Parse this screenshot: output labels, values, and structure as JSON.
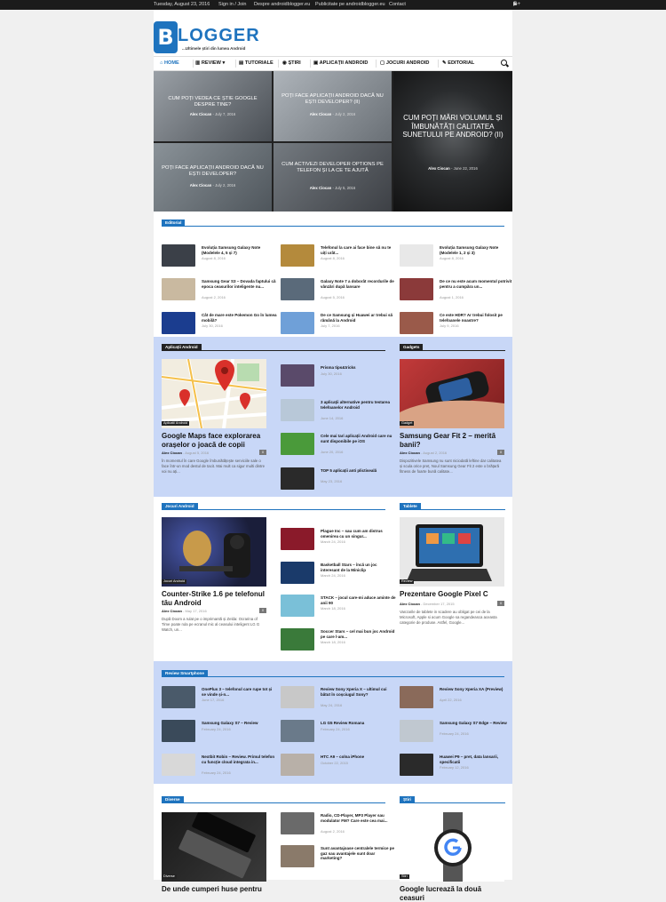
{
  "topbar": {
    "date": "Tuesday, August 23, 2016",
    "signin": "Sign in / Join",
    "about": "Despre androidblogger.eu",
    "ads": "Publicitate pe androidblogger.eu",
    "contact": "Contact",
    "icons": [
      "facebook-icon",
      "google-plus-icon",
      "instagram-icon",
      "youtube-icon"
    ]
  },
  "logo": {
    "letter": "B",
    "text": "LOGGER",
    "tagline": "...Ultimele știri din lumea Android"
  },
  "nav": {
    "items": [
      "HOME",
      "REVIEW",
      "TUTORIALE",
      "ȘTIRI",
      "APLICAȚII ANDROID",
      "JOCURI ANDROID",
      "EDITORIAL"
    ]
  },
  "hero": [
    {
      "title": "CUM POȚI VEDEA CE ȘTIE GOOGLE DESPRE TINE?",
      "author": "Alex Ciocan",
      "date": "July 7, 2016",
      "bg": "#6b7178"
    },
    {
      "title": "POȚI FACE APLICAȚII ANDROID DACĂ NU EȘTI DEVELOPER? (II)",
      "author": "Alex Ciocan",
      "date": "July 2, 2016",
      "bg": "#8a9096"
    },
    {
      "title": "CUM POȚI MĂRI VOLUMUL ȘI ÎMBUNĂTĂȚI CALITATEA SUNETULUI PE ANDROID? (II)",
      "author": "Alex Ciocan",
      "date": "June 22, 2016",
      "bg": "#2c2e2f"
    },
    {
      "title": "POȚI FACE APLICAȚII ANDROID DACĂ NU EȘTI DEVELOPER?",
      "author": "Alex Ciocan",
      "date": "July 2, 2016",
      "bg": "#737b82"
    },
    {
      "title": "CUM ACTIVEZI DEVELOPER OPTIONS PE TELEFON ȘI LA CE TE AJUTĂ",
      "author": "Alex Ciocan",
      "date": "July 5, 2016",
      "bg": "#5d6166"
    }
  ],
  "editorial": {
    "label": "Editorial",
    "items": [
      {
        "title": "Evoluția Samsung Galaxy Note (Modelele 4, 5 și 7)",
        "date": "August 8, 2016",
        "bg": "#3b4048"
      },
      {
        "title": "Telefonul la care ai face bine să nu te uiți urât...",
        "date": "August 8, 2016",
        "bg": "#b48a3c"
      },
      {
        "title": "Evoluția Samsung Galaxy Note (Modelele 1, 2 și 3)",
        "date": "August 8, 2016",
        "bg": "#e8e8e8"
      },
      {
        "title": "Samsung Gear S3 – Dovada faptului că epoca ceasurilor inteligente nu...",
        "date": "August 2, 2016",
        "bg": "#c9b9a0"
      },
      {
        "title": "Galaxy Note 7 a doborât recordurile de vânzări după lansare",
        "date": "August 5, 2016",
        "bg": "#5a6a7a"
      },
      {
        "title": "De ce nu este acum momentul potrivit pentru a cumpăra un...",
        "date": "August 1, 2016",
        "bg": "#8b3a3a"
      },
      {
        "title": "Cât de mare este Pokemon Go în lumea mobilă?",
        "date": "July 30, 2016",
        "bg": "#1b3d8f"
      },
      {
        "title": "De ce Samsung și Huawei ar trebui să rămână la Android",
        "date": "July 7, 2016",
        "bg": "#6fa0d8"
      },
      {
        "title": "Ce este HDR? Ar trebui folosit pe telefoanele noastre?",
        "date": "July 9, 2016",
        "bg": "#9a5a4a"
      }
    ]
  },
  "apps": {
    "label": "Aplicații Android",
    "main": {
      "category": "Aplicatii Android",
      "title": "Google Maps face explorarea orașelor o joacă de copii",
      "author": "Alex Ciocan",
      "date": "August 5, 2016",
      "comments": "0",
      "excerpt": "În momentul în care Google îmbunătățește serviciile sale o face într-un mod destul de tacit. Mai mult ca sigur multi dintre voi nu ați..."
    },
    "items": [
      {
        "title": "Prisma tips&tricks",
        "date": "July 30, 2016",
        "bg": "#5a4a6a"
      },
      {
        "title": "3 aplicații alternative pentru testarea telefoanelor Android",
        "date": "June 14, 2016",
        "bg": "#b8c8d8"
      },
      {
        "title": "Cele mai tari aplicații Android care nu sunt disponibile pe iOS",
        "date": "June 20, 2016",
        "bg": "#4a9a3a"
      },
      {
        "title": "TOP 5 aplicații anti plictiseală",
        "date": "May 23, 2016",
        "bg": "#2a2a2a"
      }
    ]
  },
  "gadgets": {
    "label": "Gadgets",
    "main": {
      "category": "Gadget",
      "title": "Samsung Gear Fit 2 – merită banii?",
      "author": "Alex Ciocan",
      "date": "August 2, 2016",
      "comments": "0",
      "excerpt": "Dispozitivele Samsung nu sunt niciodată leftine dar calitatea și scula orice preț. Noul Samsung Gear Fit 2 este o brățară fitness de foarte bună calitate..."
    }
  },
  "games": {
    "label": "Jocuri Android",
    "main": {
      "category": "Jocuri Android",
      "title": "Counter-Strike 1.6 pe telefonul tău Android",
      "author": "Alex Ciocan",
      "date": "May 17, 2016",
      "comments": "0",
      "excerpt": "După Doom a rulat pe o imprimantă și Zelda: Ocrarina of Time poate rula pe ecranul mic al ceasului inteligent LG G Watch, un..."
    },
    "items": [
      {
        "title": "Plague Inc – sau cum am distrus omenirea cu un singur...",
        "date": "March 24, 2016",
        "bg": "#8a1a2a"
      },
      {
        "title": "Basketball Stars – încă un joc interesant de la Miniclip",
        "date": "March 24, 2016",
        "bg": "#1a3a6a"
      },
      {
        "title": "STACK – jocul care-mi aduce aminte de anii 90",
        "date": "March 18, 2016",
        "bg": "#7ac0d8"
      },
      {
        "title": "Soccer Stars – cel mai bun joc Android pe care l-am...",
        "date": "March 18, 2016",
        "bg": "#3a7a3a"
      }
    ]
  },
  "tablets": {
    "label": "Tablete",
    "main": {
      "category": "Review",
      "title": "Prezentare Google Pixel C",
      "author": "Alex Ciocan",
      "date": "December 17, 2015",
      "comments": "0",
      "excerpt": "Vanzarile de tablete in scadere au obligat pe cei de la Microsoft, Apple si acum Google sa regandeasca aceasta categorie de produse. Astfel, Google..."
    }
  },
  "reviews": {
    "label": "Review Smartphone",
    "items": [
      {
        "title": "OnePlus 3 – telefonul care rupe tot și se vinde și-n...",
        "date": "June 17, 2016",
        "bg": "#4a5a6a"
      },
      {
        "title": "Review Sony Xperia X – ultimul cui bătut în coșciugul Sony?",
        "date": "May 24, 2016",
        "bg": "#c8c8c8"
      },
      {
        "title": "Review Sony Xperia XA (Preview)",
        "date": "April 22, 2016",
        "bg": "#8a6a5a"
      },
      {
        "title": "Samsung Galaxy S7 – Review",
        "date": "February 24, 2016",
        "bg": "#3a4a5a"
      },
      {
        "title": "LG G5 Review Romana",
        "date": "February 24, 2016",
        "bg": "#6a7a8a"
      },
      {
        "title": "Samsung Galaxy S7 Edge – Review",
        "date": "February 24, 2016",
        "bg": "#c0c8d0"
      },
      {
        "title": "Nextbit Robin – Review. Primul telefon cu funcție cloud integrata in...",
        "date": "February 24, 2016",
        "bg": "#d8d8d8"
      },
      {
        "title": "HTC A9 – colna iPhone",
        "date": "October 22, 2015",
        "bg": "#b8b0a8"
      },
      {
        "title": "Huawei P9 – pret, data lansarii, specificatii",
        "date": "February 12, 2016",
        "bg": "#2a2a2a"
      }
    ]
  },
  "diverse": {
    "label": "Diverse",
    "main": {
      "category": "Diverse",
      "title": "De unde cumperi huse pentru"
    },
    "items": [
      {
        "title": "Radio, CD-Player, MP3 Player sau modulator FM? Care este cea mai...",
        "date": "August 2, 2016",
        "bg": "#6a6a6a"
      },
      {
        "title": "Sunt avantajoase centralele termice pe gaz sau avantajele sunt doar marketing?",
        "date": "",
        "bg": "#8a7a6a"
      }
    ]
  },
  "news": {
    "label": "Știri",
    "main": {
      "category": "Stiri",
      "title": "Google lucrează la două ceasuri"
    }
  }
}
